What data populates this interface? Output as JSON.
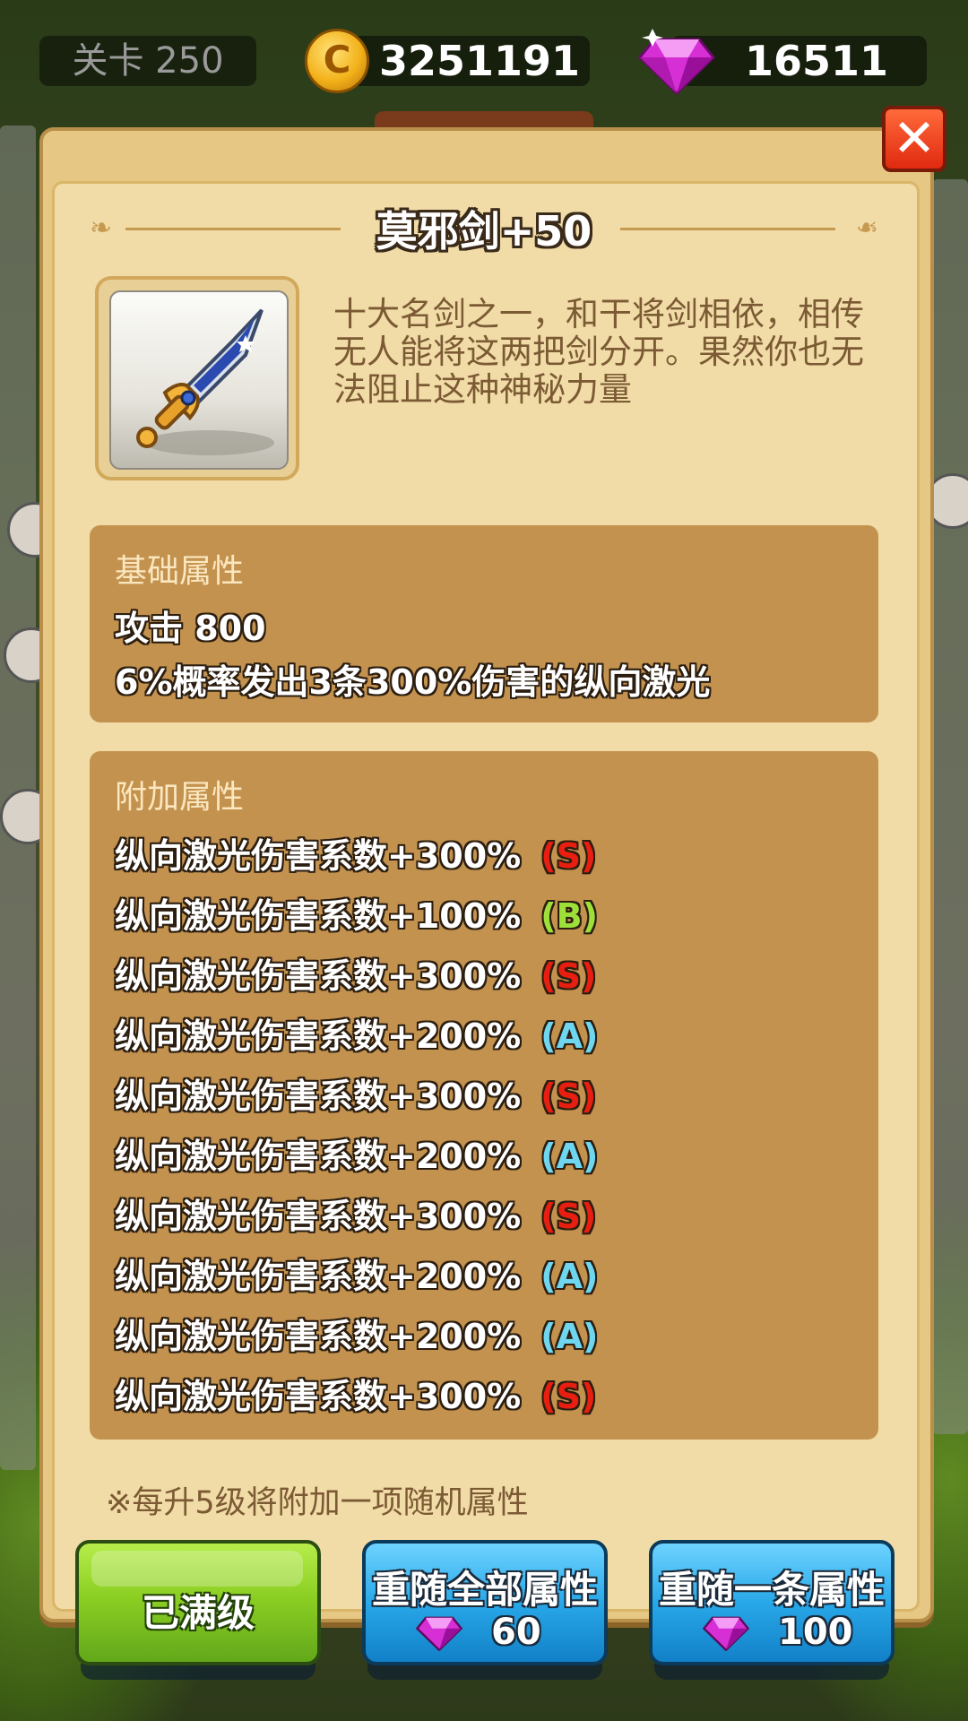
{
  "header": {
    "level": "关卡 250",
    "coins": "3251191",
    "gems": "16511",
    "coin_icon_letter": "C"
  },
  "close_glyph": "✕",
  "item": {
    "title": "莫邪剑+50",
    "description": "十大名剑之一，和干将剑相依，相传无人能将这两把剑分开。果然你也无法阻止这种神秘力量"
  },
  "base_section": {
    "heading": "基础属性",
    "attack": "攻击 800",
    "effect": "6%概率发出3条300%伤害的纵向激光"
  },
  "extra_section": {
    "heading": "附加属性",
    "attributes": [
      {
        "text": "纵向激光伤害系数+300%",
        "grade": "(S)"
      },
      {
        "text": "纵向激光伤害系数+100%",
        "grade": "(B)"
      },
      {
        "text": "纵向激光伤害系数+300%",
        "grade": "(S)"
      },
      {
        "text": "纵向激光伤害系数+200%",
        "grade": "(A)"
      },
      {
        "text": "纵向激光伤害系数+300%",
        "grade": "(S)"
      },
      {
        "text": "纵向激光伤害系数+200%",
        "grade": "(A)"
      },
      {
        "text": "纵向激光伤害系数+300%",
        "grade": "(S)"
      },
      {
        "text": "纵向激光伤害系数+200%",
        "grade": "(A)"
      },
      {
        "text": "纵向激光伤害系数+200%",
        "grade": "(A)"
      },
      {
        "text": "纵向激光伤害系数+300%",
        "grade": "(S)"
      }
    ]
  },
  "note": "※每升5级将附加一项随机属性",
  "buttons": {
    "max_level": "已满级",
    "reroll_all": {
      "label": "重随全部属性",
      "cost": "60"
    },
    "reroll_one": {
      "label": "重随一条属性",
      "cost": "100"
    }
  },
  "colors": {
    "grade_s": "#e81e10",
    "grade_a": "#6fd6f0",
    "grade_b": "#9ee03a"
  }
}
